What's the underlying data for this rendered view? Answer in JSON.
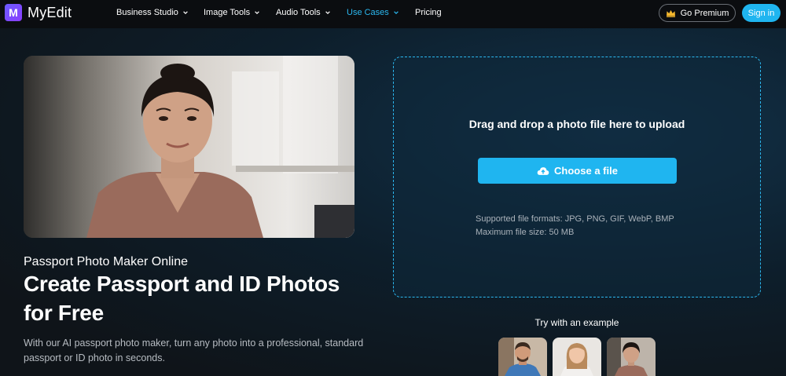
{
  "nav": {
    "logo_text": "MyEdit",
    "logo_mark": "M",
    "items": [
      {
        "label": "Business Studio",
        "has_dropdown": true,
        "active": false
      },
      {
        "label": "Image Tools",
        "has_dropdown": true,
        "active": false
      },
      {
        "label": "Audio Tools",
        "has_dropdown": true,
        "active": false
      },
      {
        "label": "Use Cases",
        "has_dropdown": true,
        "active": true
      },
      {
        "label": "Pricing",
        "has_dropdown": false,
        "active": false
      }
    ],
    "premium_label": "Go Premium",
    "signin_label": "Sign in"
  },
  "hero": {
    "subtitle": "Passport Photo Maker Online",
    "headline": "Create Passport and ID Photos for Free",
    "description": "With our AI passport photo maker, turn any photo into a professional, standard passport or ID photo in seconds."
  },
  "upload": {
    "title": "Drag and drop a photo file here to upload",
    "button_label": "Choose a file",
    "formats": "Supported file formats: JPG, PNG, GIF, WebP, BMP",
    "max_size": "Maximum file size: 50 MB"
  },
  "examples": {
    "label": "Try with an example"
  },
  "colors": {
    "accent": "#1fb5f0",
    "active_nav": "#2bb8f0",
    "nav_bg": "#0b0d10",
    "page_bg": "#0f1419"
  }
}
